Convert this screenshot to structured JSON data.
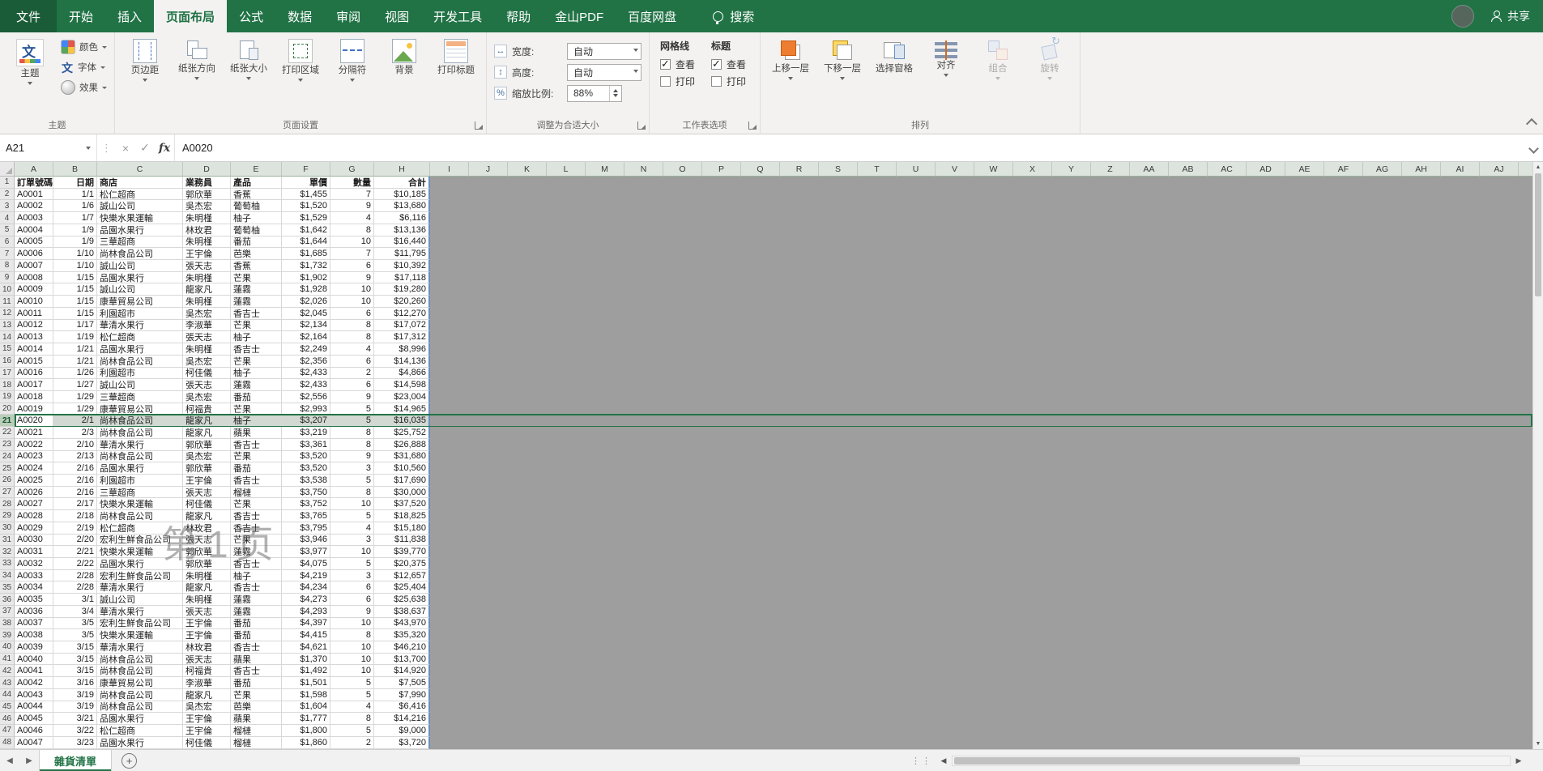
{
  "colors": {
    "ribbon_green": "#217346",
    "selection_green": "#217346",
    "outside_area_gray": "#9e9e9e",
    "print_boundary_blue": "#6a8fc0"
  },
  "ribbon": {
    "tabs": [
      "文件",
      "开始",
      "插入",
      "页面布局",
      "公式",
      "数据",
      "审阅",
      "视图",
      "开发工具",
      "帮助",
      "金山PDF",
      "百度网盘"
    ],
    "active_tab": "页面布局",
    "search_label": "搜索",
    "share_label": "共享",
    "theme_group": {
      "label": "主题",
      "big": "主题",
      "items": [
        "颜色",
        "字体",
        "效果"
      ]
    },
    "page_setup_group": {
      "label": "页面设置",
      "buttons": [
        {
          "label": "页边距",
          "icon": "margins-icon",
          "dropdown": true
        },
        {
          "label": "纸张方向",
          "icon": "orientation-icon",
          "dropdown": true
        },
        {
          "label": "纸张大小",
          "icon": "size-icon",
          "dropdown": true
        },
        {
          "label": "打印区域",
          "icon": "print-area-icon",
          "dropdown": true
        },
        {
          "label": "分隔符",
          "icon": "breaks-icon",
          "dropdown": true
        },
        {
          "label": "背景",
          "icon": "background-icon",
          "dropdown": false
        },
        {
          "label": "打印标题",
          "icon": "print-titles-icon",
          "dropdown": false
        }
      ]
    },
    "scale_group": {
      "label": "调整为合适大小",
      "width_label": "宽度:",
      "width_value": "自动",
      "height_label": "高度:",
      "height_value": "自动",
      "scale_label": "缩放比例:",
      "scale_value": "88%"
    },
    "sheet_options_group": {
      "label": "工作表选项",
      "gridlines_title": "网格线",
      "headings_title": "标题",
      "view_label": "查看",
      "print_label": "打印",
      "checks": {
        "gridlines_view": true,
        "gridlines_print": false,
        "headings_view": true,
        "headings_print": false
      }
    },
    "arrange_group": {
      "label": "排列",
      "buttons": [
        {
          "label": "上移一层",
          "icon": "bring-forward-icon",
          "dropdown": true,
          "disabled": false
        },
        {
          "label": "下移一层",
          "icon": "send-backward-icon",
          "dropdown": true,
          "disabled": false
        },
        {
          "label": "选择窗格",
          "icon": "selection-pane-icon",
          "dropdown": false,
          "disabled": false
        },
        {
          "label": "对齐",
          "icon": "align-icon",
          "dropdown": true,
          "disabled": false
        },
        {
          "label": "组合",
          "icon": "group-icon",
          "dropdown": true,
          "disabled": true
        },
        {
          "label": "旋转",
          "icon": "rotate-icon",
          "dropdown": true,
          "disabled": true
        }
      ]
    }
  },
  "formula_bar": {
    "name_box": "A21",
    "content": "A0020"
  },
  "sheet": {
    "row_count": 48,
    "selected_row": 21,
    "watermark": "第1页",
    "columns": [
      "A",
      "B",
      "C",
      "D",
      "E",
      "F",
      "G",
      "H",
      "I",
      "J",
      "K",
      "L",
      "M",
      "N",
      "O",
      "P",
      "Q",
      "R",
      "S",
      "T",
      "U",
      "V",
      "W",
      "X",
      "Y",
      "Z",
      "AA",
      "AB",
      "AC",
      "AD",
      "AE",
      "AF",
      "AG",
      "AH",
      "AI",
      "AJ"
    ],
    "table": {
      "headers": [
        "訂單號碼",
        "日期",
        "商店",
        "業務員",
        "產品",
        "單價",
        "數量",
        "合計"
      ],
      "rows": [
        [
          "A0001",
          "1/1",
          "松仁超商",
          "郭欣華",
          "香蕉",
          "$1,455",
          "7",
          "$10,185"
        ],
        [
          "A0002",
          "1/6",
          "誠山公司",
          "吳杰宏",
          "葡萄柚",
          "$1,520",
          "9",
          "$13,680"
        ],
        [
          "A0003",
          "1/7",
          "快樂水果運輸",
          "朱明槿",
          "柚子",
          "$1,529",
          "4",
          "$6,116"
        ],
        [
          "A0004",
          "1/9",
          "品園水果行",
          "林玫君",
          "葡萄柚",
          "$1,642",
          "8",
          "$13,136"
        ],
        [
          "A0005",
          "1/9",
          "三華超商",
          "朱明槿",
          "番茄",
          "$1,644",
          "10",
          "$16,440"
        ],
        [
          "A0006",
          "1/10",
          "尚林食品公司",
          "王宇倫",
          "芭樂",
          "$1,685",
          "7",
          "$11,795"
        ],
        [
          "A0007",
          "1/10",
          "誠山公司",
          "張天志",
          "香蕉",
          "$1,732",
          "6",
          "$10,392"
        ],
        [
          "A0008",
          "1/15",
          "品園水果行",
          "朱明槿",
          "芒果",
          "$1,902",
          "9",
          "$17,118"
        ],
        [
          "A0009",
          "1/15",
          "誠山公司",
          "龍家凡",
          "蓮霧",
          "$1,928",
          "10",
          "$19,280"
        ],
        [
          "A0010",
          "1/15",
          "康華貿易公司",
          "朱明槿",
          "蓮霧",
          "$2,026",
          "10",
          "$20,260"
        ],
        [
          "A0011",
          "1/15",
          "利園超市",
          "吳杰宏",
          "香吉士",
          "$2,045",
          "6",
          "$12,270"
        ],
        [
          "A0012",
          "1/17",
          "華清水果行",
          "李淑華",
          "芒果",
          "$2,134",
          "8",
          "$17,072"
        ],
        [
          "A0013",
          "1/19",
          "松仁超商",
          "張天志",
          "柚子",
          "$2,164",
          "8",
          "$17,312"
        ],
        [
          "A0014",
          "1/21",
          "品園水果行",
          "朱明槿",
          "香吉士",
          "$2,249",
          "4",
          "$8,996"
        ],
        [
          "A0015",
          "1/21",
          "尚林食品公司",
          "吳杰宏",
          "芒果",
          "$2,356",
          "6",
          "$14,136"
        ],
        [
          "A0016",
          "1/26",
          "利園超市",
          "柯佳儀",
          "柚子",
          "$2,433",
          "2",
          "$4,866"
        ],
        [
          "A0017",
          "1/27",
          "誠山公司",
          "張天志",
          "蓮霧",
          "$2,433",
          "6",
          "$14,598"
        ],
        [
          "A0018",
          "1/29",
          "三華超商",
          "吳杰宏",
          "番茄",
          "$2,556",
          "9",
          "$23,004"
        ],
        [
          "A0019",
          "1/29",
          "康華貿易公司",
          "柯福貴",
          "芒果",
          "$2,993",
          "5",
          "$14,965"
        ],
        [
          "A0020",
          "2/1",
          "尚林食品公司",
          "龍家凡",
          "柚子",
          "$3,207",
          "5",
          "$16,035"
        ],
        [
          "A0021",
          "2/3",
          "尚林食品公司",
          "龍家凡",
          "蘋果",
          "$3,219",
          "8",
          "$25,752"
        ],
        [
          "A0022",
          "2/10",
          "華清水果行",
          "郭欣華",
          "香吉士",
          "$3,361",
          "8",
          "$26,888"
        ],
        [
          "A0023",
          "2/13",
          "尚林食品公司",
          "吳杰宏",
          "芒果",
          "$3,520",
          "9",
          "$31,680"
        ],
        [
          "A0024",
          "2/16",
          "品園水果行",
          "郭欣華",
          "番茄",
          "$3,520",
          "3",
          "$10,560"
        ],
        [
          "A0025",
          "2/16",
          "利園超市",
          "王宇倫",
          "香吉士",
          "$3,538",
          "5",
          "$17,690"
        ],
        [
          "A0026",
          "2/16",
          "三華超商",
          "張天志",
          "榴槤",
          "$3,750",
          "8",
          "$30,000"
        ],
        [
          "A0027",
          "2/17",
          "快樂水果運輸",
          "柯佳儀",
          "芒果",
          "$3,752",
          "10",
          "$37,520"
        ],
        [
          "A0028",
          "2/18",
          "尚林食品公司",
          "龍家凡",
          "香吉士",
          "$3,765",
          "5",
          "$18,825"
        ],
        [
          "A0029",
          "2/19",
          "松仁超商",
          "林玫君",
          "香吉士",
          "$3,795",
          "4",
          "$15,180"
        ],
        [
          "A0030",
          "2/20",
          "宏利生鮮食品公司",
          "張天志",
          "芒果",
          "$3,946",
          "3",
          "$11,838"
        ],
        [
          "A0031",
          "2/21",
          "快樂水果運輸",
          "郭欣華",
          "蓮霧",
          "$3,977",
          "10",
          "$39,770"
        ],
        [
          "A0032",
          "2/22",
          "品園水果行",
          "郭欣華",
          "香吉士",
          "$4,075",
          "5",
          "$20,375"
        ],
        [
          "A0033",
          "2/28",
          "宏利生鮮食品公司",
          "朱明槿",
          "柚子",
          "$4,219",
          "3",
          "$12,657"
        ],
        [
          "A0034",
          "2/28",
          "華清水果行",
          "龍家凡",
          "香吉士",
          "$4,234",
          "6",
          "$25,404"
        ],
        [
          "A0035",
          "3/1",
          "誠山公司",
          "朱明槿",
          "蓮霧",
          "$4,273",
          "6",
          "$25,638"
        ],
        [
          "A0036",
          "3/4",
          "華清水果行",
          "張天志",
          "蓮霧",
          "$4,293",
          "9",
          "$38,637"
        ],
        [
          "A0037",
          "3/5",
          "宏利生鮮食品公司",
          "王宇倫",
          "番茄",
          "$4,397",
          "10",
          "$43,970"
        ],
        [
          "A0038",
          "3/5",
          "快樂水果運輸",
          "王宇倫",
          "番茄",
          "$4,415",
          "8",
          "$35,320"
        ],
        [
          "A0039",
          "3/15",
          "華清水果行",
          "林玫君",
          "香吉士",
          "$4,621",
          "10",
          "$46,210"
        ],
        [
          "A0040",
          "3/15",
          "尚林食品公司",
          "張天志",
          "蘋果",
          "$1,370",
          "10",
          "$13,700"
        ],
        [
          "A0041",
          "3/15",
          "尚林食品公司",
          "柯福貴",
          "香吉士",
          "$1,492",
          "10",
          "$14,920"
        ],
        [
          "A0042",
          "3/16",
          "康華貿易公司",
          "李淑華",
          "番茄",
          "$1,501",
          "5",
          "$7,505"
        ],
        [
          "A0043",
          "3/19",
          "尚林食品公司",
          "龍家凡",
          "芒果",
          "$1,598",
          "5",
          "$7,990"
        ],
        [
          "A0044",
          "3/19",
          "尚林食品公司",
          "吳杰宏",
          "芭樂",
          "$1,604",
          "4",
          "$6,416"
        ],
        [
          "A0045",
          "3/21",
          "品園水果行",
          "王宇倫",
          "蘋果",
          "$1,777",
          "8",
          "$14,216"
        ],
        [
          "A0046",
          "3/22",
          "松仁超商",
          "王宇倫",
          "榴槤",
          "$1,800",
          "5",
          "$9,000"
        ],
        [
          "A0047",
          "3/23",
          "品園水果行",
          "柯佳儀",
          "榴槤",
          "$1,860",
          "2",
          "$3,720"
        ]
      ]
    }
  },
  "tab_bar": {
    "sheet_name": "雜貨清單"
  }
}
